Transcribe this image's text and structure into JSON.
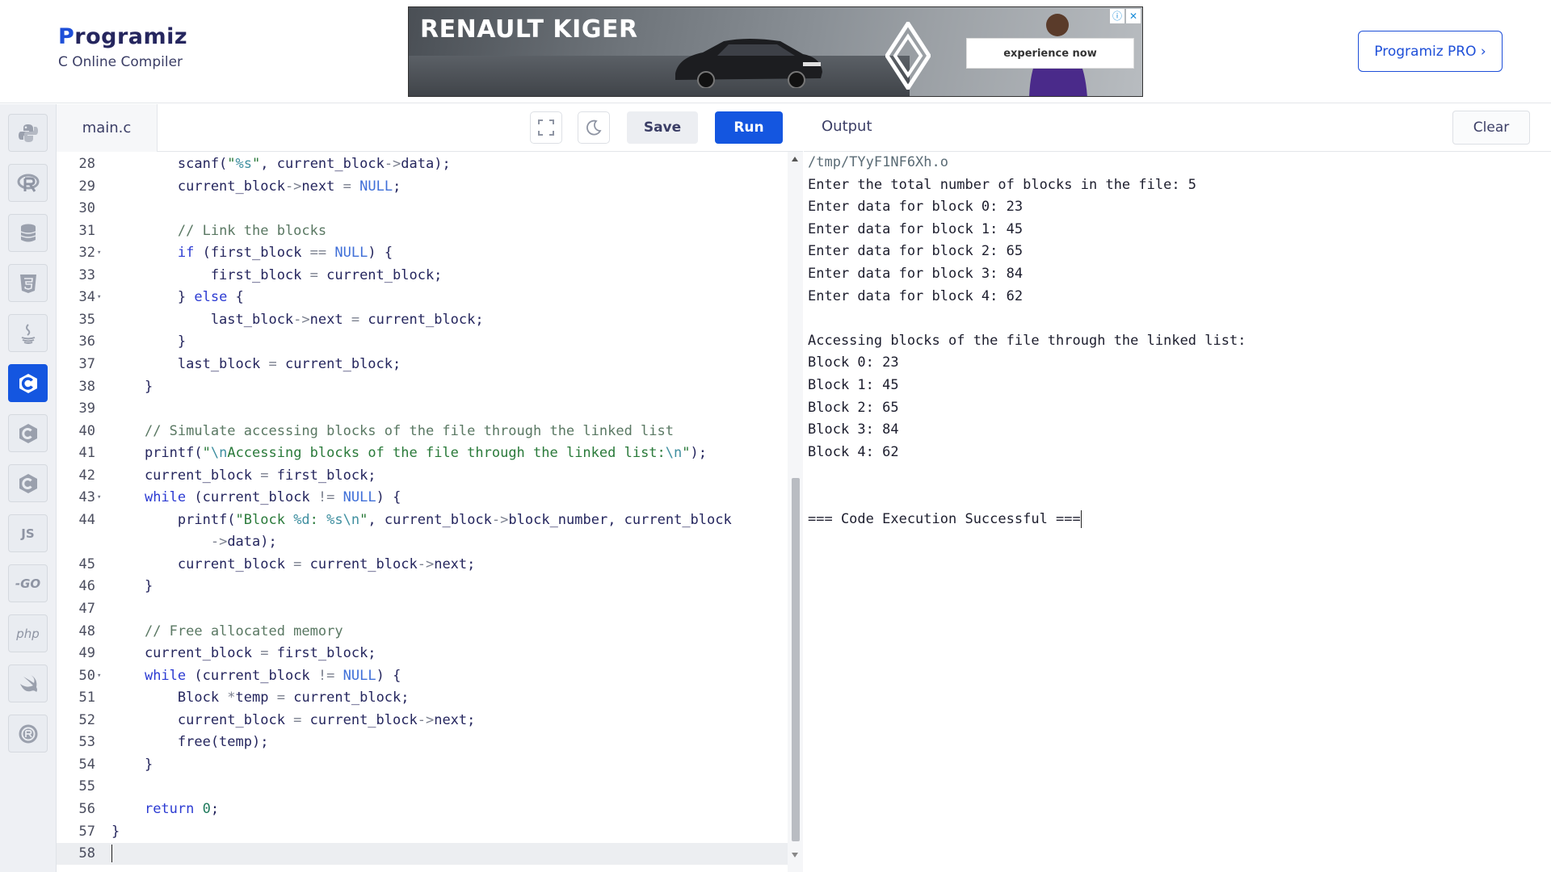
{
  "header": {
    "logo_text_rest": "rogramiz",
    "logo_letter": "P",
    "subtitle": "C Online Compiler",
    "pro_button": "Programiz PRO ›"
  },
  "ad": {
    "title": "RENAULT KIGER",
    "cta": "experience now",
    "info_icon": "info-icon",
    "close_icon": "close-icon"
  },
  "rail": {
    "items": [
      {
        "name": "python",
        "icon": "python-icon"
      },
      {
        "name": "r",
        "icon": "r-icon"
      },
      {
        "name": "sql",
        "icon": "database-icon"
      },
      {
        "name": "html",
        "icon": "html5-icon"
      },
      {
        "name": "java",
        "icon": "java-icon"
      },
      {
        "name": "c",
        "icon": "c-icon",
        "active": true
      },
      {
        "name": "cpp",
        "icon": "cpp-icon"
      },
      {
        "name": "csharp",
        "icon": "csharp-icon"
      },
      {
        "name": "js",
        "label": "JS"
      },
      {
        "name": "go",
        "label": "-GO"
      },
      {
        "name": "php",
        "label": "php"
      },
      {
        "name": "swift",
        "icon": "swift-icon"
      },
      {
        "name": "rust",
        "icon": "rust-icon"
      }
    ]
  },
  "editor": {
    "file_tab": "main.c",
    "save_label": "Save",
    "run_label": "Run",
    "current_line": 58,
    "lines": [
      {
        "n": "28",
        "fold": false,
        "text": "        scanf(\"%s\", current_block->data);"
      },
      {
        "n": "29",
        "fold": false,
        "text": "        current_block->next = NULL;"
      },
      {
        "n": "30",
        "fold": false,
        "text": ""
      },
      {
        "n": "31",
        "fold": false,
        "text": "        // Link the blocks"
      },
      {
        "n": "32",
        "fold": true,
        "text": "        if (first_block == NULL) {"
      },
      {
        "n": "33",
        "fold": false,
        "text": "            first_block = current_block;"
      },
      {
        "n": "34",
        "fold": true,
        "text": "        } else {"
      },
      {
        "n": "35",
        "fold": false,
        "text": "            last_block->next = current_block;"
      },
      {
        "n": "36",
        "fold": false,
        "text": "        }"
      },
      {
        "n": "37",
        "fold": false,
        "text": "        last_block = current_block;"
      },
      {
        "n": "38",
        "fold": false,
        "text": "    }"
      },
      {
        "n": "39",
        "fold": false,
        "text": ""
      },
      {
        "n": "40",
        "fold": false,
        "text": "    // Simulate accessing blocks of the file through the linked list"
      },
      {
        "n": "41",
        "fold": false,
        "text": "    printf(\"\\nAccessing blocks of the file through the linked list:\\n\");"
      },
      {
        "n": "42",
        "fold": false,
        "text": "    current_block = first_block;"
      },
      {
        "n": "43",
        "fold": true,
        "text": "    while (current_block != NULL) {"
      },
      {
        "n": "44",
        "fold": false,
        "text": "        printf(\"Block %d: %s\\n\", current_block->block_number, current_block"
      },
      {
        "n": "",
        "fold": false,
        "text": "            ->data);"
      },
      {
        "n": "45",
        "fold": false,
        "text": "        current_block = current_block->next;"
      },
      {
        "n": "46",
        "fold": false,
        "text": "    }"
      },
      {
        "n": "47",
        "fold": false,
        "text": ""
      },
      {
        "n": "48",
        "fold": false,
        "text": "    // Free allocated memory"
      },
      {
        "n": "49",
        "fold": false,
        "text": "    current_block = first_block;"
      },
      {
        "n": "50",
        "fold": true,
        "text": "    while (current_block != NULL) {"
      },
      {
        "n": "51",
        "fold": false,
        "text": "        Block *temp = current_block;"
      },
      {
        "n": "52",
        "fold": false,
        "text": "        current_block = current_block->next;"
      },
      {
        "n": "53",
        "fold": false,
        "text": "        free(temp);"
      },
      {
        "n": "54",
        "fold": false,
        "text": "    }"
      },
      {
        "n": "55",
        "fold": false,
        "text": ""
      },
      {
        "n": "56",
        "fold": false,
        "text": "    return 0;"
      },
      {
        "n": "57",
        "fold": false,
        "text": "}"
      },
      {
        "n": "58",
        "fold": false,
        "text": ""
      }
    ]
  },
  "output": {
    "title": "Output",
    "clear_label": "Clear",
    "lines": [
      "/tmp/TYyF1NF6Xh.o",
      "Enter the total number of blocks in the file: 5",
      "Enter data for block 0: 23",
      "Enter data for block 1: 45",
      "Enter data for block 2: 65",
      "Enter data for block 3: 84",
      "Enter data for block 4: 62",
      "",
      "Accessing blocks of the file through the linked list:",
      "Block 0: 23",
      "Block 1: 45",
      "Block 2: 65",
      "Block 3: 84",
      "Block 4: 62",
      "",
      "",
      "=== Code Execution Successful ==="
    ]
  },
  "colors": {
    "accent": "#1456e0",
    "keyword": "#2c3bd2",
    "string": "#2a7a3a",
    "comment": "#5a7863"
  }
}
